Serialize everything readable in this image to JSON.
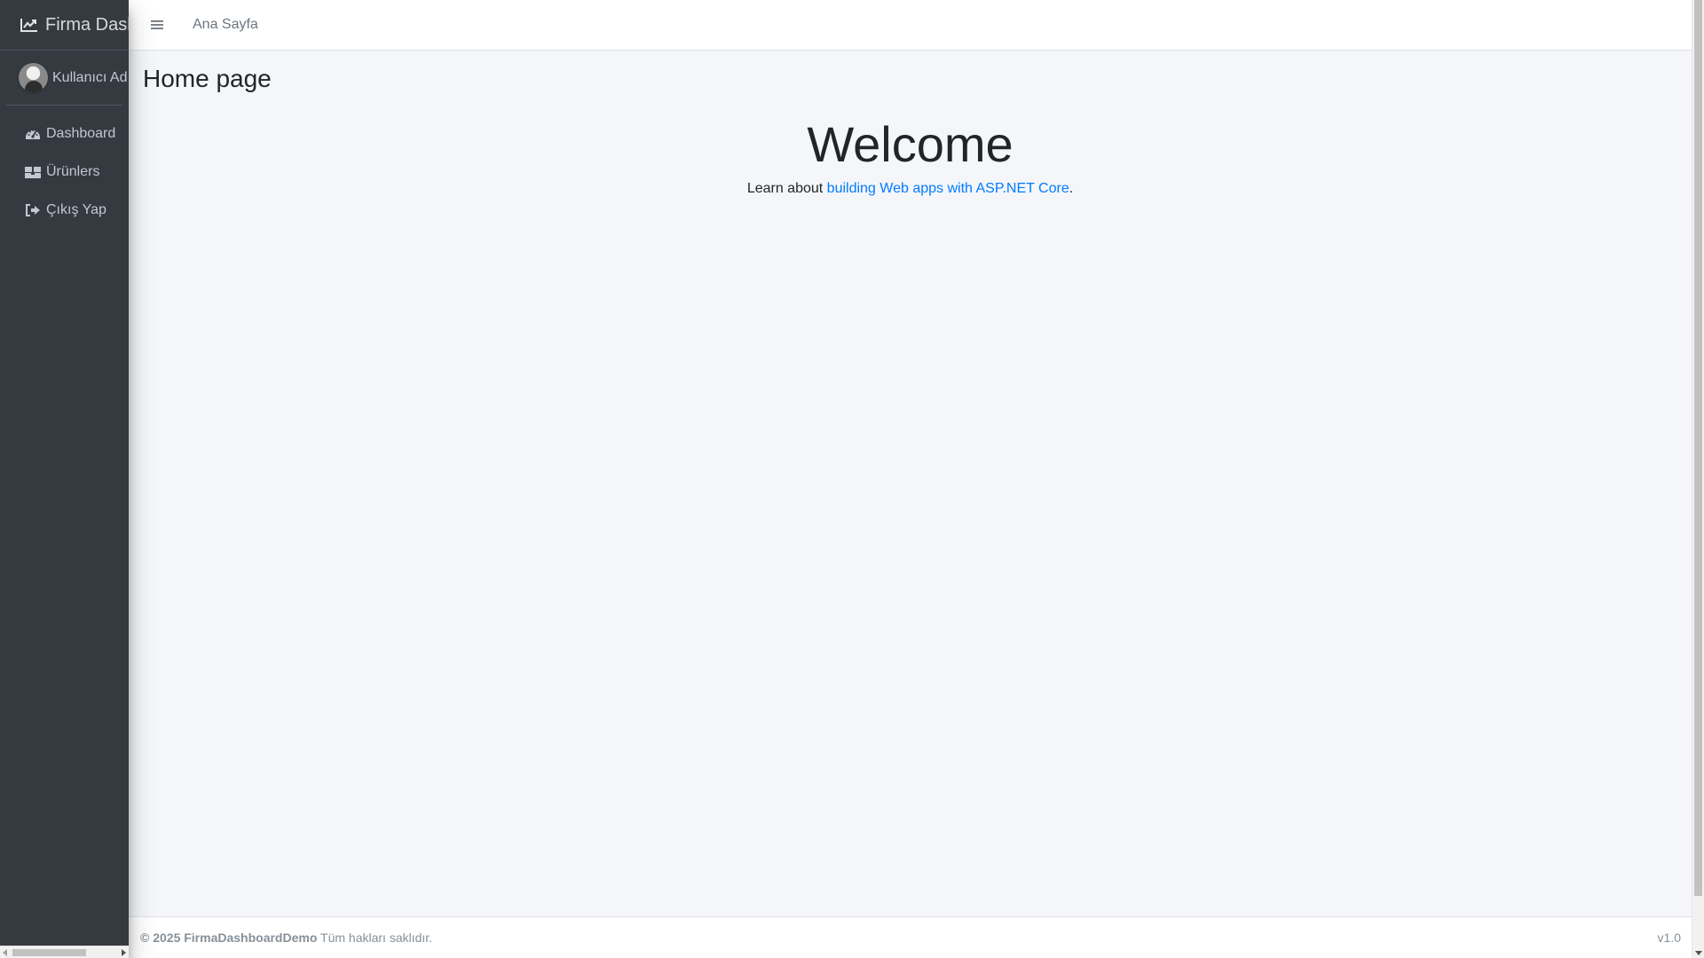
{
  "sidebar": {
    "brand": "Firma Dashboard",
    "user_name": "Kullanıcı Adı",
    "items": [
      {
        "label": "Dashboard",
        "icon": "tachometer-icon"
      },
      {
        "label": "Ürünlers",
        "icon": "boxes-icon"
      },
      {
        "label": "Çıkış Yap",
        "icon": "sign-out-icon"
      }
    ]
  },
  "topbar": {
    "home_link": "Ana Sayfa"
  },
  "main": {
    "page_title": "Home page",
    "welcome_title": "Welcome",
    "learn_prefix": "Learn about ",
    "learn_link": "building Web apps with ASP.NET Core",
    "learn_suffix": "."
  },
  "footer": {
    "copyright": "© 2025 FirmaDashboardDemo",
    "rights": " Tüm hakları saklıdır.",
    "version": "v1.0"
  },
  "colors": {
    "sidebar_bg": "#343a40",
    "content_bg": "#f4f6f9",
    "link": "#007bff"
  }
}
